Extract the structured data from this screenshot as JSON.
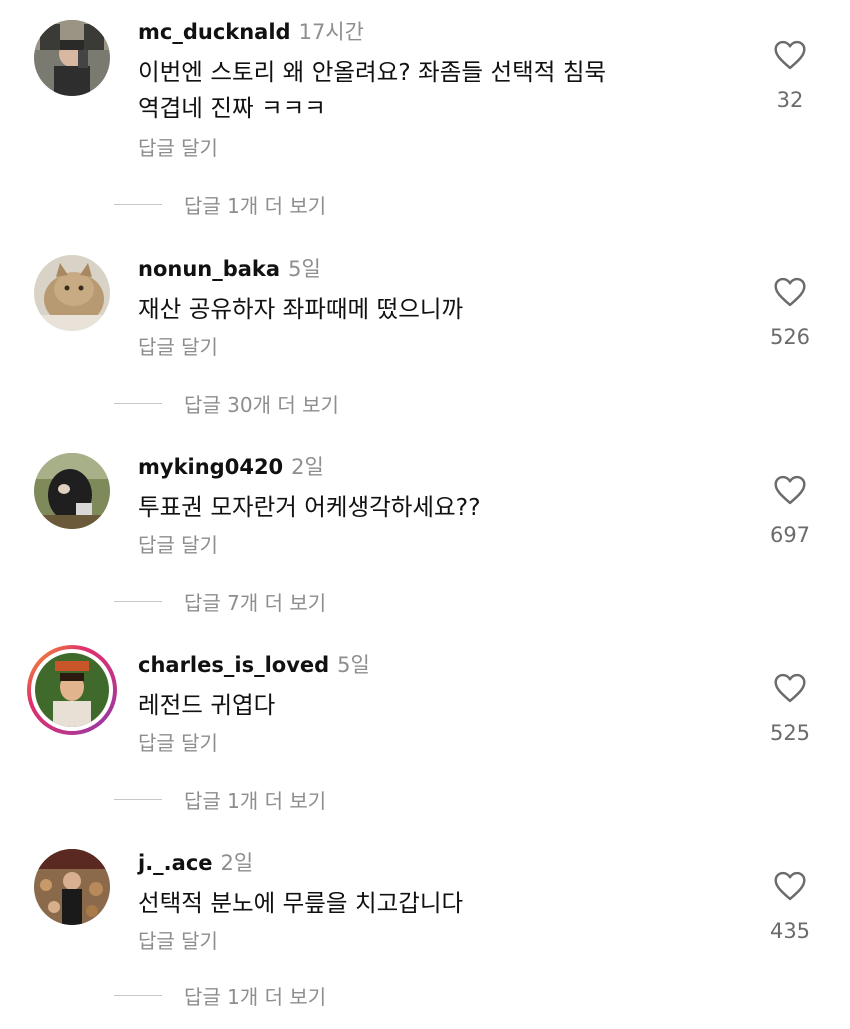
{
  "comments": [
    {
      "username": "mc_ducknald",
      "time": "17시간",
      "text_lines": [
        "이번엔 스토리 왜 안올려요? 좌좀들 선택적 침묵",
        "역겹네 진짜 ㅋㅋㅋ"
      ],
      "reply_label": "답글 달기",
      "more_label": "답글 1개 더 보기",
      "likes": "32"
    },
    {
      "username": "nonun_baka",
      "time": "5일",
      "text_lines": [
        "재산 공유하자 좌파때메 떴으니까"
      ],
      "reply_label": "답글 달기",
      "more_label": "답글 30개 더 보기",
      "likes": "526"
    },
    {
      "username": "myking0420",
      "time": "2일",
      "text_lines": [
        "투표권 모자란거 어케생각하세요??"
      ],
      "reply_label": "답글 달기",
      "more_label": "답글 7개 더 보기",
      "likes": "697"
    },
    {
      "username": "charles_is_loved",
      "time": "5일",
      "text_lines": [
        "레전드 귀엽다"
      ],
      "reply_label": "답글 달기",
      "more_label": "답글 1개 더 보기",
      "likes": "525"
    },
    {
      "username": "j._.ace",
      "time": "2일",
      "text_lines": [
        "선택적 분노에 무릎을 치고갑니다"
      ],
      "reply_label": "답글 달기",
      "more_label": "답글 1개 더 보기",
      "likes": "435"
    }
  ]
}
